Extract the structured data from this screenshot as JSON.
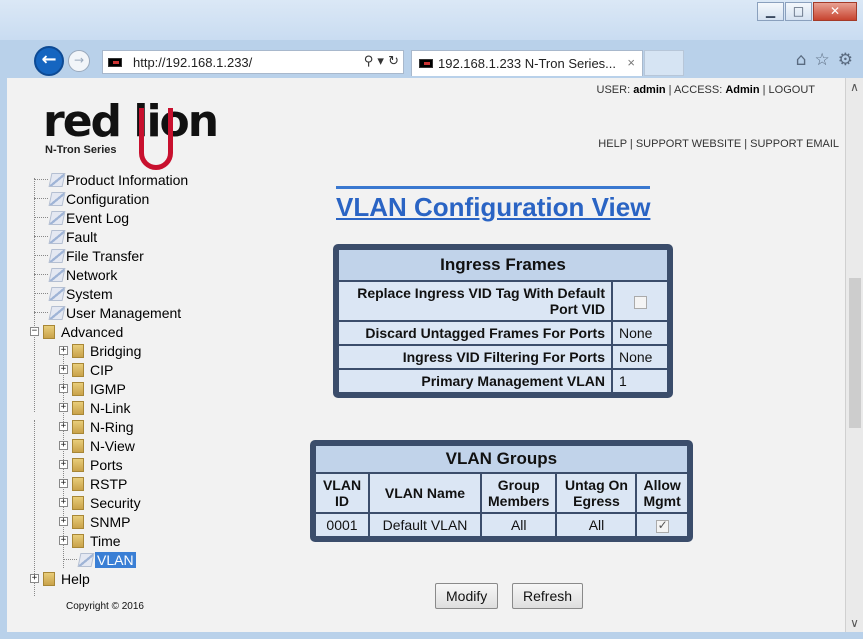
{
  "browser": {
    "url": "http://192.168.1.233/",
    "tab_title": "192.168.1.233 N-Tron Series...",
    "tab_close": "×",
    "addr_tools": "⚲ ▾ ↻",
    "back_glyph": "←",
    "fwd_glyph": "→",
    "toolbar_icons": {
      "home": "⌂",
      "favorites": "☆",
      "settings": "⚙"
    },
    "window_controls": {
      "minimize": "▁",
      "maximize": "□",
      "close": "✕"
    }
  },
  "header": {
    "logo_text": "red lion",
    "logo_sub": "N-Tron Series",
    "user_label": "USER: ",
    "user": "admin",
    "access_label": "  |  ACCESS: ",
    "access": "Admin",
    "logout": "LOGOUT",
    "links": [
      "HELP",
      "SUPPORT WEBSITE",
      "SUPPORT EMAIL"
    ],
    "sep": "  |  "
  },
  "tree": {
    "items": [
      {
        "label": "Product Information",
        "type": "page"
      },
      {
        "label": "Configuration",
        "type": "page"
      },
      {
        "label": "Event Log",
        "type": "page"
      },
      {
        "label": "Fault",
        "type": "page"
      },
      {
        "label": "File Transfer",
        "type": "page"
      },
      {
        "label": "Network",
        "type": "page"
      },
      {
        "label": "System",
        "type": "page"
      },
      {
        "label": "User Management",
        "type": "page"
      },
      {
        "label": "Advanced",
        "type": "folder",
        "expanded": true
      },
      {
        "label": "Bridging",
        "type": "folder",
        "indent": 1
      },
      {
        "label": "CIP",
        "type": "folder",
        "indent": 1
      },
      {
        "label": "IGMP",
        "type": "folder",
        "indent": 1
      },
      {
        "label": "N-Link",
        "type": "folder",
        "indent": 1
      },
      {
        "label": "N-Ring",
        "type": "folder",
        "indent": 1
      },
      {
        "label": "N-View",
        "type": "folder",
        "indent": 1
      },
      {
        "label": "Ports",
        "type": "folder",
        "indent": 1
      },
      {
        "label": "RSTP",
        "type": "folder",
        "indent": 1
      },
      {
        "label": "Security",
        "type": "folder",
        "indent": 1
      },
      {
        "label": "SNMP",
        "type": "folder",
        "indent": 1
      },
      {
        "label": "Time",
        "type": "folder",
        "indent": 1
      },
      {
        "label": "VLAN",
        "type": "page",
        "indent": 1,
        "selected": true
      },
      {
        "label": "Help",
        "type": "folder"
      }
    ],
    "expand_glyph": "+",
    "collapse_glyph": "−"
  },
  "copyright": "Copyright © 2016",
  "main": {
    "title": "VLAN Configuration View",
    "ingress": {
      "header": "Ingress Frames",
      "rows": [
        {
          "label": "Replace Ingress VID Tag With Default Port VID",
          "value": "",
          "checkbox": false
        },
        {
          "label": "Discard Untagged Frames For Ports",
          "value": "None"
        },
        {
          "label": "Ingress VID Filtering For Ports",
          "value": "None"
        },
        {
          "label": "Primary Management VLAN",
          "value": "1"
        }
      ]
    },
    "groups": {
      "header": "VLAN Groups",
      "columns": [
        "VLAN ID",
        "VLAN Name",
        "Group Members",
        "Untag On Egress",
        "Allow Mgmt"
      ],
      "rows": [
        {
          "vlan_id": "0001",
          "vlan_name": "Default VLAN",
          "members": "All",
          "untag": "All",
          "allow_mgmt": true
        }
      ]
    },
    "buttons": {
      "modify": "Modify",
      "refresh": "Refresh"
    }
  },
  "scroll": {
    "up": "∧",
    "down": "∨"
  },
  "colors": {
    "title": "#2a64c4",
    "panel_border": "#3b4d6b",
    "cell": "#dbe6f4",
    "selected": "#3a7fd5",
    "brand_red": "#c8102e"
  }
}
